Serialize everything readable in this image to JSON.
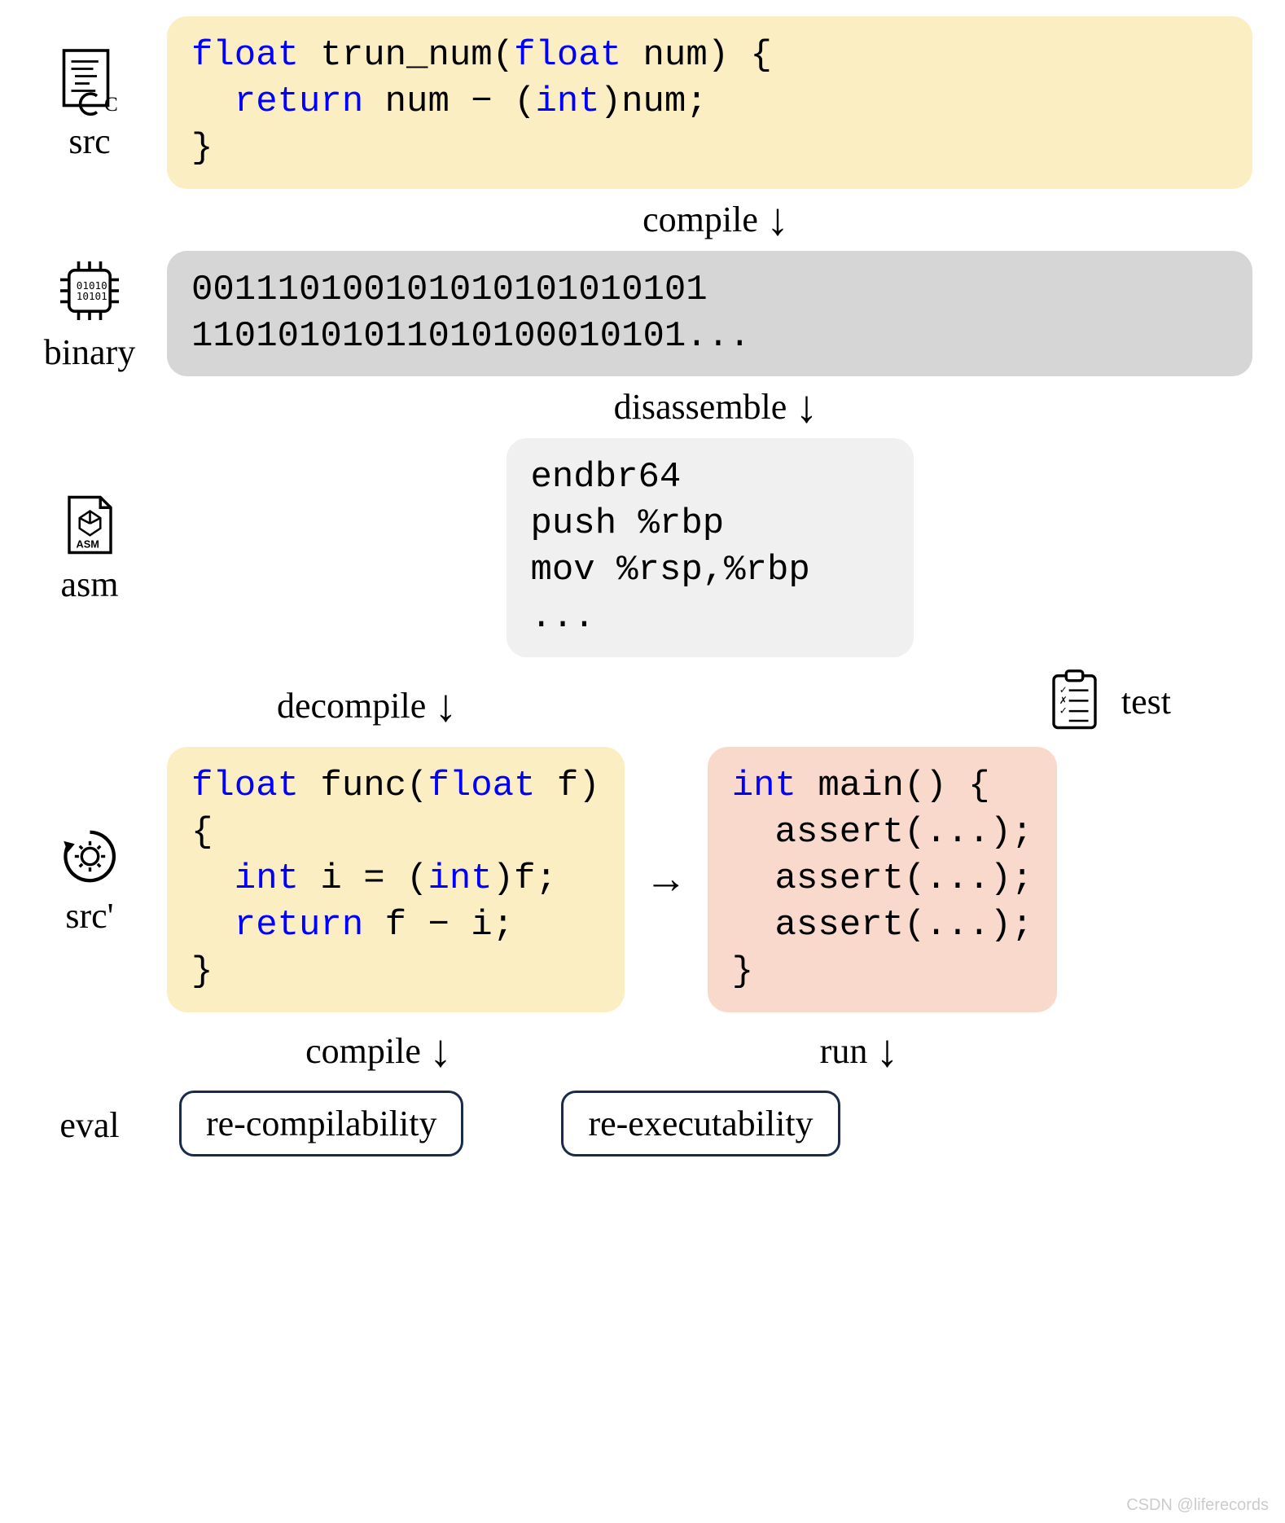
{
  "labels": {
    "src": "src",
    "binary": "binary",
    "asm": "asm",
    "srcprime": "src'",
    "eval": "eval",
    "test": "test"
  },
  "arrows": {
    "compile": "compile",
    "disassemble": "disassemble",
    "decompile": "decompile",
    "compile2": "compile",
    "run": "run"
  },
  "code": {
    "src": {
      "l1_kw1": "float",
      "l1_name": " trun_num(",
      "l1_kw2": "float",
      "l1_rest": " num) {",
      "l2_kw": "  return",
      "l2_mid": " num − (",
      "l2_kw2": "int",
      "l2_rest": ")num;",
      "l3": "}"
    },
    "binary": {
      "l1": "001110100101010101010101",
      "l2": "11010101011010100010101..."
    },
    "asm": {
      "l1": "endbr64",
      "l2": "push %rbp",
      "l3": "mov %rsp,%rbp",
      "l4": "..."
    },
    "srcprime": {
      "l1_kw1": "float",
      "l1_name": " func(",
      "l1_kw2": "float",
      "l1_rest": " f)",
      "l2": "{",
      "l3_kw": "  int",
      "l3_mid": " i = (",
      "l3_kw2": "int",
      "l3_rest": ")f;",
      "l4_kw": "  return",
      "l4_rest": " f − i;",
      "l5": "}"
    },
    "test": {
      "l1_kw": "int",
      "l1_rest": " main() {",
      "l2": "  assert(...);",
      "l3": "  assert(...);",
      "l4": "  assert(...);",
      "l5": "}"
    }
  },
  "eval": {
    "recompilability": "re-compilability",
    "reexecutability": "re-executability"
  },
  "watermark": "CSDN @liferecords"
}
